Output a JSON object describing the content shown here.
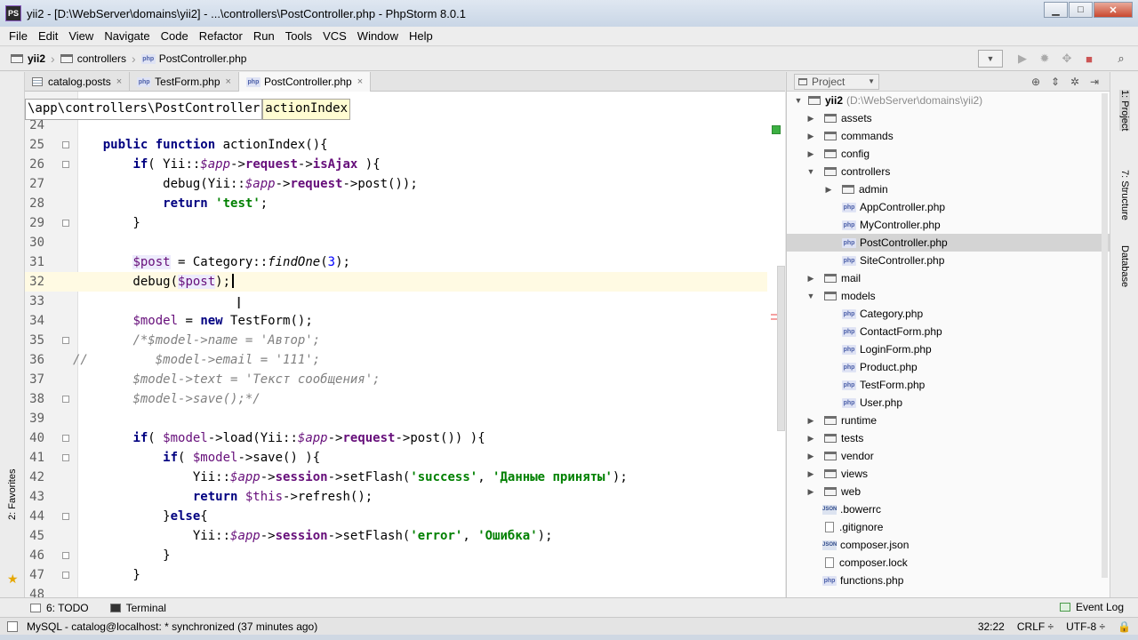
{
  "window": {
    "app_icon": "PS",
    "title": "yii2 - [D:\\WebServer\\domains\\yii2] - ...\\controllers\\PostController.php - PhpStorm 8.0.1",
    "minimize": "▁",
    "maximize": "□",
    "close": "✕"
  },
  "menu": [
    "File",
    "Edit",
    "View",
    "Navigate",
    "Code",
    "Refactor",
    "Run",
    "Tools",
    "VCS",
    "Window",
    "Help"
  ],
  "breadcrumb": {
    "root": "yii2",
    "folder": "controllers",
    "file": "PostController.php",
    "sep": "›"
  },
  "editor_tabs": [
    {
      "label": "catalog.posts",
      "icon": "database-table-icon",
      "active": false
    },
    {
      "label": "TestForm.php",
      "icon": "php-file-icon",
      "active": false
    },
    {
      "label": "PostController.php",
      "icon": "php-file-icon",
      "active": true
    }
  ],
  "tab_close": "×",
  "php_badge": "php",
  "json_badge": "JSON",
  "code_crumbs": {
    "path": "\\app\\controllers\\PostController",
    "method": "actionIndex"
  },
  "code_lines": [
    {
      "n": "24",
      "fold": false,
      "current": false,
      "tokens": []
    },
    {
      "n": "25",
      "fold": true,
      "current": false,
      "tokens": [
        {
          "t": "    "
        },
        {
          "t": "public function ",
          "c": "kw"
        },
        {
          "t": "actionIndex(){"
        }
      ]
    },
    {
      "n": "26",
      "fold": true,
      "current": false,
      "tokens": [
        {
          "t": "        "
        },
        {
          "t": "if",
          "c": "kw"
        },
        {
          "t": "( Yii::"
        },
        {
          "t": "$app",
          "c": "fld"
        },
        {
          "t": "->"
        },
        {
          "t": "request",
          "c": "fld-b"
        },
        {
          "t": "->"
        },
        {
          "t": "isAjax",
          "c": "fld-b"
        },
        {
          "t": " ){"
        }
      ]
    },
    {
      "n": "27",
      "fold": false,
      "current": false,
      "tokens": [
        {
          "t": "            debug(Yii::"
        },
        {
          "t": "$app",
          "c": "fld"
        },
        {
          "t": "->"
        },
        {
          "t": "request",
          "c": "fld-b"
        },
        {
          "t": "->post());"
        }
      ]
    },
    {
      "n": "28",
      "fold": false,
      "current": false,
      "tokens": [
        {
          "t": "            "
        },
        {
          "t": "return ",
          "c": "kw"
        },
        {
          "t": "'test'",
          "c": "str"
        },
        {
          "t": ";"
        }
      ]
    },
    {
      "n": "29",
      "fold": true,
      "current": false,
      "tokens": [
        {
          "t": "        }"
        }
      ]
    },
    {
      "n": "30",
      "fold": false,
      "current": false,
      "tokens": []
    },
    {
      "n": "31",
      "fold": false,
      "current": false,
      "tokens": [
        {
          "t": "        "
        },
        {
          "t": "$post",
          "c": "var-bg"
        },
        {
          "t": " = Category::"
        },
        {
          "t": "findOne",
          "c": "st"
        },
        {
          "t": "("
        },
        {
          "t": "3",
          "c": "num"
        },
        {
          "t": ");"
        }
      ]
    },
    {
      "n": "32",
      "fold": false,
      "current": true,
      "caret": true,
      "tokens": [
        {
          "t": "        debug("
        },
        {
          "t": "$post",
          "c": "var-bg"
        },
        {
          "t": ");"
        }
      ]
    },
    {
      "n": "33",
      "fold": false,
      "current": false,
      "tokens": []
    },
    {
      "n": "34",
      "fold": false,
      "current": false,
      "tokens": [
        {
          "t": "        "
        },
        {
          "t": "$model",
          "c": "var"
        },
        {
          "t": " = "
        },
        {
          "t": "new ",
          "c": "kw"
        },
        {
          "t": "TestForm();"
        }
      ]
    },
    {
      "n": "35",
      "fold": true,
      "current": false,
      "tokens": [
        {
          "t": "        "
        },
        {
          "t": "/*$model->name = 'Автор';",
          "c": "cmt"
        }
      ]
    },
    {
      "n": "36",
      "fold": false,
      "current": false,
      "tokens": [
        {
          "t": "//         $model->email = '111';",
          "c": "cmt"
        }
      ]
    },
    {
      "n": "37",
      "fold": false,
      "current": false,
      "tokens": [
        {
          "t": "        "
        },
        {
          "t": "$model->text = 'Текст сообщения';",
          "c": "cmt"
        }
      ]
    },
    {
      "n": "38",
      "fold": true,
      "current": false,
      "tokens": [
        {
          "t": "        "
        },
        {
          "t": "$model->save();*/",
          "c": "cmt"
        }
      ]
    },
    {
      "n": "39",
      "fold": false,
      "current": false,
      "tokens": []
    },
    {
      "n": "40",
      "fold": true,
      "current": false,
      "tokens": [
        {
          "t": "        "
        },
        {
          "t": "if",
          "c": "kw"
        },
        {
          "t": "( "
        },
        {
          "t": "$model",
          "c": "var"
        },
        {
          "t": "->load(Yii::"
        },
        {
          "t": "$app",
          "c": "fld"
        },
        {
          "t": "->"
        },
        {
          "t": "request",
          "c": "fld-b"
        },
        {
          "t": "->post()) ){"
        }
      ]
    },
    {
      "n": "41",
      "fold": true,
      "current": false,
      "tokens": [
        {
          "t": "            "
        },
        {
          "t": "if",
          "c": "kw"
        },
        {
          "t": "( "
        },
        {
          "t": "$model",
          "c": "var"
        },
        {
          "t": "->save() ){"
        }
      ]
    },
    {
      "n": "42",
      "fold": false,
      "current": false,
      "tokens": [
        {
          "t": "                Yii::"
        },
        {
          "t": "$app",
          "c": "fld"
        },
        {
          "t": "->"
        },
        {
          "t": "session",
          "c": "fld-b"
        },
        {
          "t": "->setFlash("
        },
        {
          "t": "'success'",
          "c": "str"
        },
        {
          "t": ", "
        },
        {
          "t": "'Данные приняты'",
          "c": "str"
        },
        {
          "t": ");"
        }
      ]
    },
    {
      "n": "43",
      "fold": false,
      "current": false,
      "tokens": [
        {
          "t": "                "
        },
        {
          "t": "return ",
          "c": "kw"
        },
        {
          "t": "$this",
          "c": "var"
        },
        {
          "t": "->refresh();"
        }
      ]
    },
    {
      "n": "44",
      "fold": true,
      "current": false,
      "tokens": [
        {
          "t": "            }"
        },
        {
          "t": "else",
          "c": "kw"
        },
        {
          "t": "{"
        }
      ]
    },
    {
      "n": "45",
      "fold": false,
      "current": false,
      "tokens": [
        {
          "t": "                Yii::"
        },
        {
          "t": "$app",
          "c": "fld"
        },
        {
          "t": "->"
        },
        {
          "t": "session",
          "c": "fld-b"
        },
        {
          "t": "->setFlash("
        },
        {
          "t": "'error'",
          "c": "str"
        },
        {
          "t": ", "
        },
        {
          "t": "'Ошибка'",
          "c": "str"
        },
        {
          "t": ");"
        }
      ]
    },
    {
      "n": "46",
      "fold": true,
      "current": false,
      "tokens": [
        {
          "t": "            }"
        }
      ]
    },
    {
      "n": "47",
      "fold": true,
      "current": false,
      "tokens": [
        {
          "t": "        }"
        }
      ]
    },
    {
      "n": "48",
      "fold": false,
      "current": false,
      "tokens": []
    }
  ],
  "project": {
    "view_select": "Project",
    "root_label": "yii2",
    "root_path": "(D:\\WebServer\\domains\\yii2)",
    "items": [
      {
        "label": "assets",
        "kind": "folder",
        "depth": 1,
        "arrow": "▶"
      },
      {
        "label": "commands",
        "kind": "folder",
        "depth": 1,
        "arrow": "▶"
      },
      {
        "label": "config",
        "kind": "folder",
        "depth": 1,
        "arrow": "▶"
      },
      {
        "label": "controllers",
        "kind": "folder",
        "depth": 1,
        "arrow": "▼"
      },
      {
        "label": "admin",
        "kind": "folder",
        "depth": 2,
        "arrow": "▶"
      },
      {
        "label": "AppController.php",
        "kind": "php",
        "depth": 2
      },
      {
        "label": "MyController.php",
        "kind": "php",
        "depth": 2
      },
      {
        "label": "PostController.php",
        "kind": "php",
        "depth": 2,
        "selected": true
      },
      {
        "label": "SiteController.php",
        "kind": "php",
        "depth": 2
      },
      {
        "label": "mail",
        "kind": "folder",
        "depth": 1,
        "arrow": "▶"
      },
      {
        "label": "models",
        "kind": "folder",
        "depth": 1,
        "arrow": "▼"
      },
      {
        "label": "Category.php",
        "kind": "php",
        "depth": 2
      },
      {
        "label": "ContactForm.php",
        "kind": "php",
        "depth": 2
      },
      {
        "label": "LoginForm.php",
        "kind": "php",
        "depth": 2
      },
      {
        "label": "Product.php",
        "kind": "php",
        "depth": 2
      },
      {
        "label": "TestForm.php",
        "kind": "php",
        "depth": 2
      },
      {
        "label": "User.php",
        "kind": "php",
        "depth": 2
      },
      {
        "label": "runtime",
        "kind": "folder",
        "depth": 1,
        "arrow": "▶"
      },
      {
        "label": "tests",
        "kind": "folder",
        "depth": 1,
        "arrow": "▶"
      },
      {
        "label": "vendor",
        "kind": "folder",
        "depth": 1,
        "arrow": "▶"
      },
      {
        "label": "views",
        "kind": "folder",
        "depth": 1,
        "arrow": "▶"
      },
      {
        "label": "web",
        "kind": "folder",
        "depth": 1,
        "arrow": "▶"
      },
      {
        "label": ".bowerrc",
        "kind": "json",
        "depth": 1
      },
      {
        "label": ".gitignore",
        "kind": "file",
        "depth": 1
      },
      {
        "label": "composer.json",
        "kind": "json",
        "depth": 1
      },
      {
        "label": "composer.lock",
        "kind": "file",
        "depth": 1
      },
      {
        "label": "functions.php",
        "kind": "php",
        "depth": 1
      }
    ]
  },
  "right_tabs": [
    "1: Project",
    "7: Structure",
    "Database"
  ],
  "left_tab": "2: Favorites",
  "bottom_tabs": {
    "todo": "6: TODO",
    "terminal": "Terminal",
    "event_log": "Event Log"
  },
  "status": {
    "message": "MySQL - catalog@localhost: * synchronized (37 minutes ago)",
    "position": "32:22",
    "line_sep": "CRLF ÷",
    "encoding": "UTF-8 ÷"
  }
}
